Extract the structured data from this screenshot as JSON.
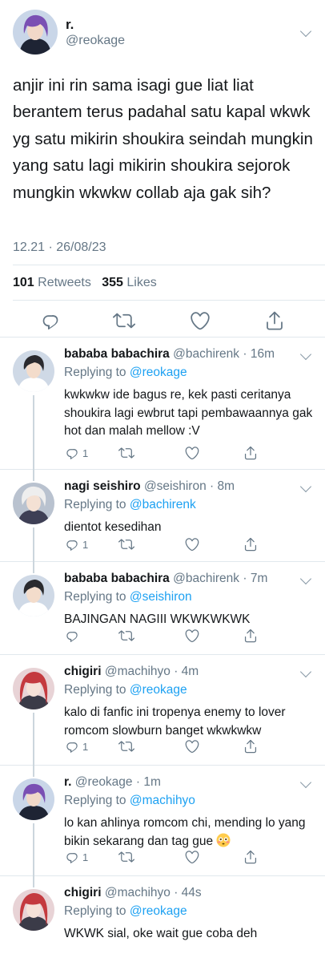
{
  "main_tweet": {
    "name": "r.",
    "handle": "@reokage",
    "text": "anjir ini rin sama isagi gue liat liat berantem terus padahal satu kapal wkwk yg satu mikirin shoukira seindah mungkin yang satu lagi mikirin shoukira sejorok mungkin wkwkw collab aja gak sih?",
    "time": "12.21 · 26/08/23",
    "retweets_count": "101",
    "retweets_label": "Retweets",
    "likes_count": "355",
    "likes_label": "Likes"
  },
  "replies": [
    {
      "name": "bababa babachira",
      "handle_time": "@bachirenk · 16m",
      "replying_prefix": "Replying to",
      "replying_to": "@reokage",
      "text": "kwkwkw ide bagus re, kek pasti ceritanya shoukira lagi ewbrut tapi pembawaannya gak hot dan malah mellow :V",
      "reply_count": "1"
    },
    {
      "name": "nagi seishiro",
      "handle_time": "@seishiron · 8m",
      "replying_prefix": "Replying to",
      "replying_to": "@bachirenk",
      "text": "dientot kesedihan",
      "reply_count": "1"
    },
    {
      "name": "bababa babachira",
      "handle_time": "@bachirenk · 7m",
      "replying_prefix": "Replying to",
      "replying_to": "@seishiron",
      "text": "BAJINGAN NAGIII WKWKWKWK",
      "reply_count": ""
    },
    {
      "name": "chigiri",
      "handle_time": "@machihyo · 4m",
      "replying_prefix": "Replying to",
      "replying_to": "@reokage",
      "text": "kalo di fanfic ini tropenya enemy to lover romcom slowburn banget wkwkwkw",
      "reply_count": "1"
    },
    {
      "name": "r.",
      "handle_time": "@reokage · 1m",
      "replying_prefix": "Replying to",
      "replying_to": "@machihyo",
      "text": "lo kan ahlinya romcom chi, mending lo yang bikin sekarang dan tag gue",
      "emoji": "flushed-face-emoji",
      "reply_count": "1"
    },
    {
      "name": "chigiri",
      "handle_time": "@machihyo · 44s",
      "replying_prefix": "Replying to",
      "replying_to": "@reokage",
      "text": "WKWK sial, oke wait gue coba deh",
      "reply_count": ""
    }
  ],
  "icons": [
    "chevron-down-icon",
    "reply-icon",
    "retweet-icon",
    "like-icon",
    "share-icon"
  ],
  "colors": {
    "link": "#1da1f2",
    "secondary_text": "#657786",
    "divider": "#e1e8ed",
    "thread_line": "#ccd6dd"
  }
}
